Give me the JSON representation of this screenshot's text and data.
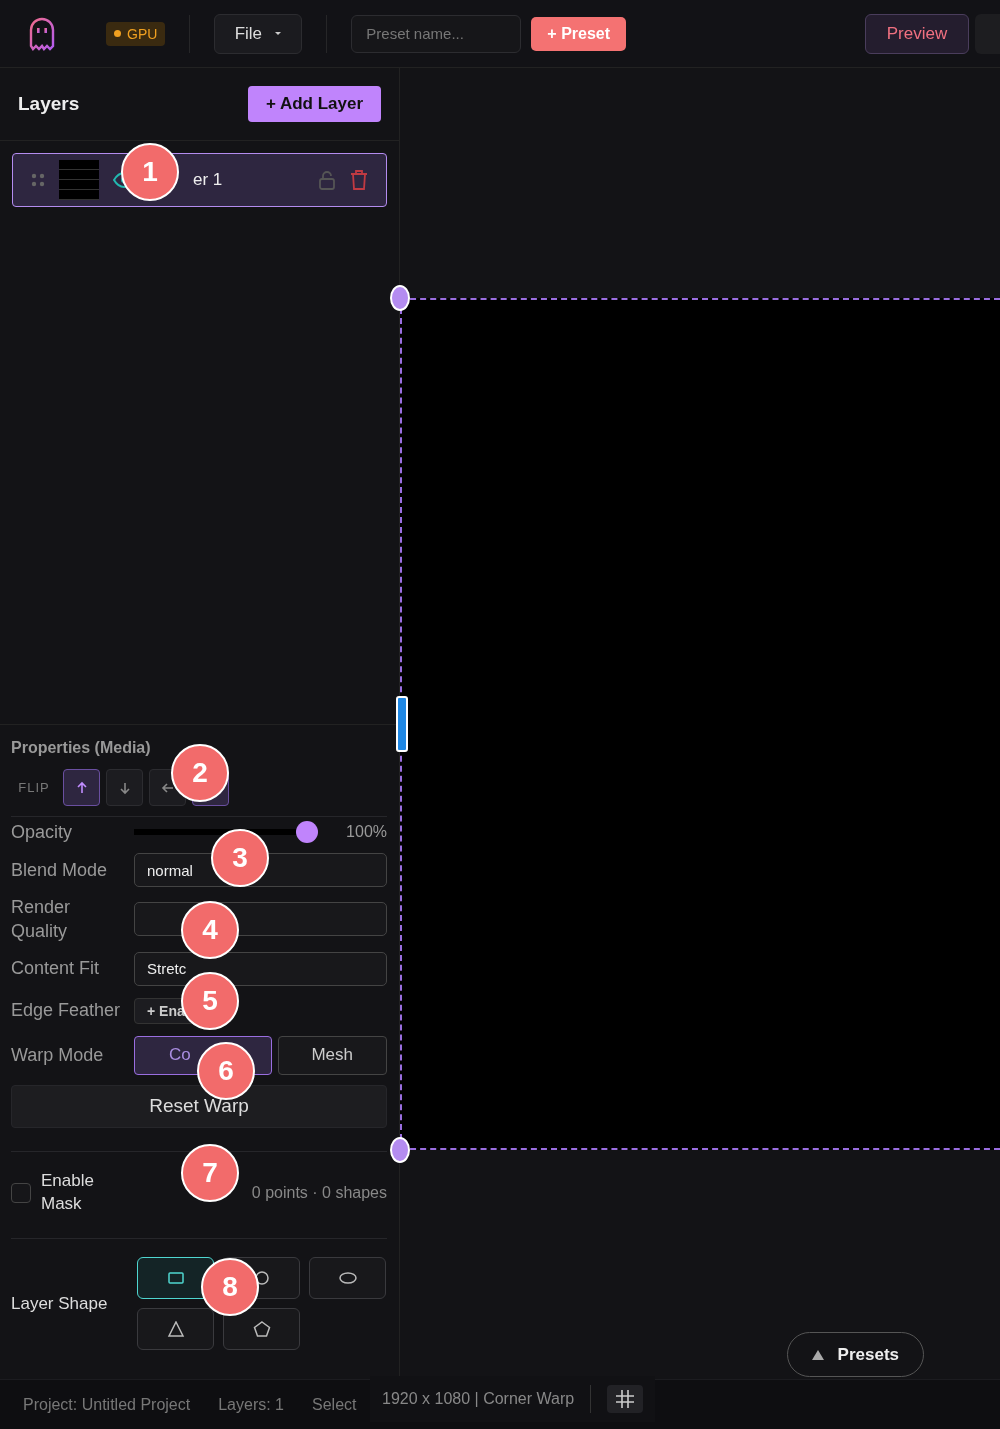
{
  "toolbar": {
    "gpu_badge": "GPU",
    "file_menu": "File",
    "preset_name": {
      "placeholder": "Preset name..."
    },
    "add_preset": "+ Preset",
    "preview": "Preview"
  },
  "layers_panel": {
    "title": "Layers",
    "add_button": "+ Add Layer",
    "layers": [
      {
        "name": "er 1",
        "selected": true,
        "visible": true,
        "locked": false
      }
    ]
  },
  "properties": {
    "title": "Properties (Media)",
    "flip_label": "FLIP",
    "flip_buttons": [
      {
        "kind": "up",
        "selected": true
      },
      {
        "kind": "down",
        "selected": false
      },
      {
        "kind": "left",
        "selected": false
      },
      {
        "kind": "right",
        "selected": true
      }
    ],
    "opacity": {
      "label": "Opacity",
      "level": 0.96,
      "reading": "100%"
    },
    "fields": [
      {
        "label": "Blend Mode",
        "value": "normal"
      },
      {
        "label": "Render Quality"
      },
      {
        "label": "Content Fit",
        "value": "Stretc"
      }
    ],
    "edge_feather": {
      "label": "Edge Feather",
      "button": "+ Ena"
    },
    "warp_mode": {
      "label": "Warp Mode",
      "options": [
        {
          "label": "Co",
          "selected": true
        },
        {
          "label": "Mesh",
          "selected": false
        }
      ]
    },
    "reset_button": "Reset Warp",
    "mask": {
      "label": "Enable Mask",
      "checked": false,
      "summary": "0 points · 0 shapes"
    },
    "layer_shape": {
      "label": "Layer Shape",
      "shapes": [
        {
          "kind": "rectangle",
          "selected": true
        },
        {
          "kind": "circle",
          "selected": false
        },
        {
          "kind": "ellipse",
          "selected": false
        },
        {
          "kind": "triangle",
          "selected": false
        },
        {
          "kind": "pentagon",
          "selected": false
        }
      ]
    }
  },
  "canvas": {
    "presets_button": "Presets"
  },
  "status_bar": {
    "project": "Project: Untitled Project",
    "layers": "Layers: 1",
    "selection": "Select",
    "canvas_info": "1920 x 1080 | Corner Warp"
  },
  "callouts": [
    "1",
    "2",
    "3",
    "4",
    "5",
    "6",
    "7",
    "8"
  ]
}
